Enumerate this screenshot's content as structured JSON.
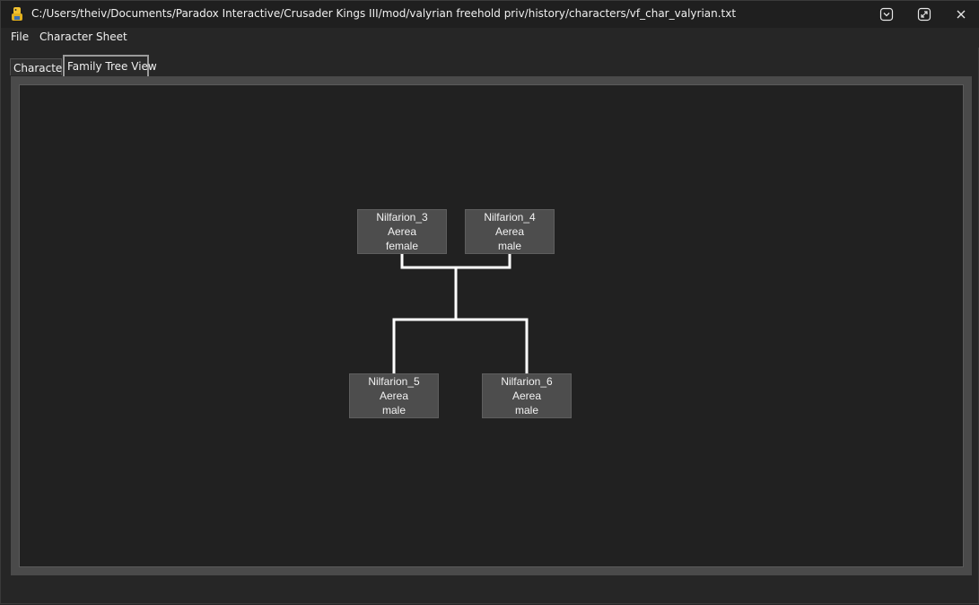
{
  "window": {
    "title": "C:/Users/theiv/Documents/Paradox Interactive/Crusader Kings III/mod/valyrian freehold priv/history/characters/vf_char_valyrian.txt",
    "app_icon": "python-icon",
    "buttons": [
      "collapse-icon",
      "maximize-icon",
      "close-icon"
    ]
  },
  "menu": {
    "file": "File",
    "character_sheet": "Character Sheet"
  },
  "tabs": [
    {
      "label": "Character",
      "active": false
    },
    {
      "label": "Family Tree View",
      "active": true
    }
  ],
  "family_tree": {
    "parents": [
      {
        "name": "Nilfarion_3",
        "dynasty": "Aerea",
        "gender": "female"
      },
      {
        "name": "Nilfarion_4",
        "dynasty": "Aerea",
        "gender": "male"
      }
    ],
    "children": [
      {
        "name": "Nilfarion_5",
        "dynasty": "Aerea",
        "gender": "male"
      },
      {
        "name": "Nilfarion_6",
        "dynasty": "Aerea",
        "gender": "male"
      }
    ]
  },
  "colors": {
    "background": "#262626",
    "canvas": "#212121",
    "node": "#4d4d4d",
    "link": "#ffffff"
  }
}
